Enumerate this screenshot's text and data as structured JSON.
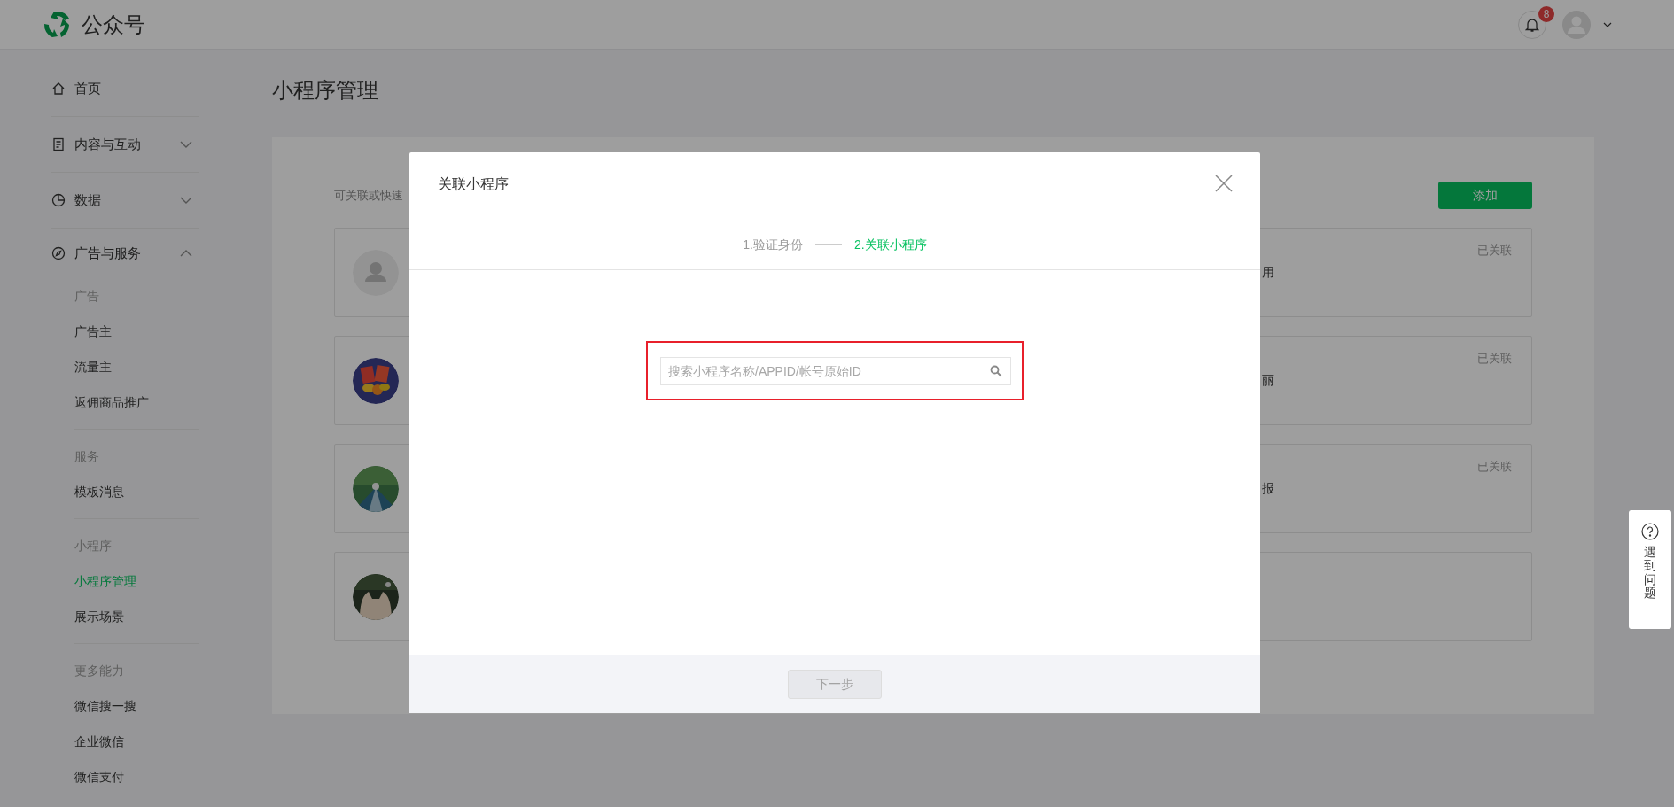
{
  "topbar": {
    "brand": "公众号",
    "notification_count": "8"
  },
  "sidebar": {
    "sections": [
      {
        "label": "首页"
      },
      {
        "label": "内容与互动",
        "expanded": false
      },
      {
        "label": "数据",
        "expanded": false
      },
      {
        "label": "广告与服务",
        "expanded": true,
        "groups": [
          {
            "heading": "广告",
            "items": [
              {
                "label": "广告主",
                "selected": false
              },
              {
                "label": "流量主",
                "selected": false
              },
              {
                "label": "返佣商品推广",
                "selected": false
              }
            ]
          },
          {
            "heading": "服务",
            "items": [
              {
                "label": "模板消息",
                "selected": false
              }
            ]
          },
          {
            "heading": "小程序",
            "items": [
              {
                "label": "小程序管理",
                "selected": true
              },
              {
                "label": "展示场景",
                "selected": false
              }
            ]
          },
          {
            "heading": "更多能力",
            "items": [
              {
                "label": "微信搜一搜",
                "selected": false
              },
              {
                "label": "企业微信",
                "selected": false
              },
              {
                "label": "微信支付",
                "selected": false
              }
            ]
          }
        ]
      }
    ]
  },
  "main": {
    "title": "小程序管理",
    "intro": "可关联或快速",
    "add_button": "添加",
    "cards": [
      {
        "kind": "placeholder",
        "text": "用",
        "status": "已关联"
      },
      {
        "kind": "picture",
        "text": "丽",
        "status": "已关联"
      },
      {
        "kind": "picture",
        "text": "报",
        "status": "已关联"
      },
      {
        "kind": "picture"
      }
    ]
  },
  "modal": {
    "title": "关联小程序",
    "steps": [
      {
        "label": "1.验证身份",
        "selected": false
      },
      {
        "label": "2.关联小程序",
        "selected": true
      }
    ],
    "search": {
      "placeholder": "搜索小程序名称/APPID/帐号原始ID",
      "highlighted": true
    },
    "next_button": {
      "label": "下一步",
      "disabled": true
    }
  },
  "help": {
    "label": "遇到问题"
  }
}
